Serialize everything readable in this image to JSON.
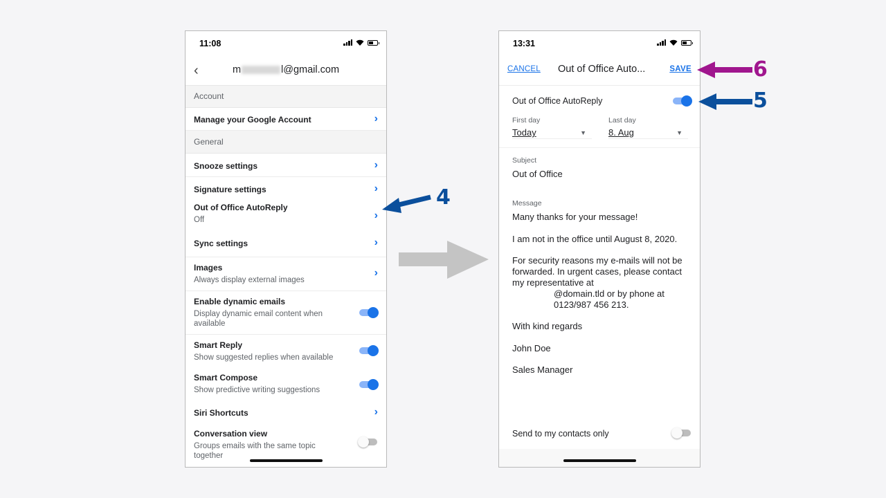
{
  "left_phone": {
    "status_time": "11:08",
    "nav": {
      "back_icon": "chevron-left-icon",
      "email_prefix": "m",
      "email_suffix": "l@gmail.com"
    },
    "sections": [
      {
        "header": "Account"
      },
      {
        "header": "General"
      }
    ],
    "account_items": [
      {
        "title": "Manage your Google Account",
        "type": "link"
      }
    ],
    "general_items": [
      {
        "title": "Snooze settings",
        "type": "link"
      },
      {
        "title": "Signature settings",
        "type": "link"
      },
      {
        "title": "Out of Office AutoReply",
        "subtitle": "Off",
        "type": "link"
      },
      {
        "title": "Sync settings",
        "type": "link"
      },
      {
        "title": "Images",
        "subtitle": "Always display external images",
        "type": "link"
      },
      {
        "title": "Enable dynamic emails",
        "subtitle": "Display dynamic email content when available",
        "type": "toggle",
        "on": true
      },
      {
        "title": "Smart Reply",
        "subtitle": "Show suggested replies when available",
        "type": "toggle",
        "on": true
      },
      {
        "title": "Smart Compose",
        "subtitle": "Show predictive writing suggestions",
        "type": "toggle",
        "on": true
      },
      {
        "title": "Siri Shortcuts",
        "type": "link"
      },
      {
        "title": "Conversation view",
        "subtitle": "Groups emails with the same topic together",
        "type": "toggle",
        "on": false
      }
    ]
  },
  "right_phone": {
    "status_time": "13:31",
    "nav": {
      "cancel": "CANCEL",
      "title": "Out of Office Auto...",
      "save": "SAVE"
    },
    "autoreply": {
      "label": "Out of Office AutoReply",
      "on": true
    },
    "first_day": {
      "label": "First day",
      "value": "Today"
    },
    "last_day": {
      "label": "Last day",
      "value": "8. Aug"
    },
    "subject": {
      "label": "Subject",
      "value": "Out of Office"
    },
    "message": {
      "label": "Message",
      "paragraphs": [
        "Many thanks for your message!",
        "I am not in the office until August 8, 2020.",
        "For security reasons my e-mails will not be forwarded. In urgent cases, please contact my representative at",
        "@domain.tld or by phone at 0123/987 456 213.",
        "With kind regards",
        "John Doe",
        "Sales Manager"
      ]
    },
    "contacts_only": {
      "label": "Send to my contacts only",
      "on": false
    }
  },
  "annotations": {
    "step4": "4",
    "step5": "5",
    "step6": "6",
    "colors": {
      "blue_arrow": "#0b4f9c",
      "purple_arrow": "#a0168e",
      "grey_arrow": "#c4c4c4",
      "accent": "#1a73e8"
    }
  }
}
